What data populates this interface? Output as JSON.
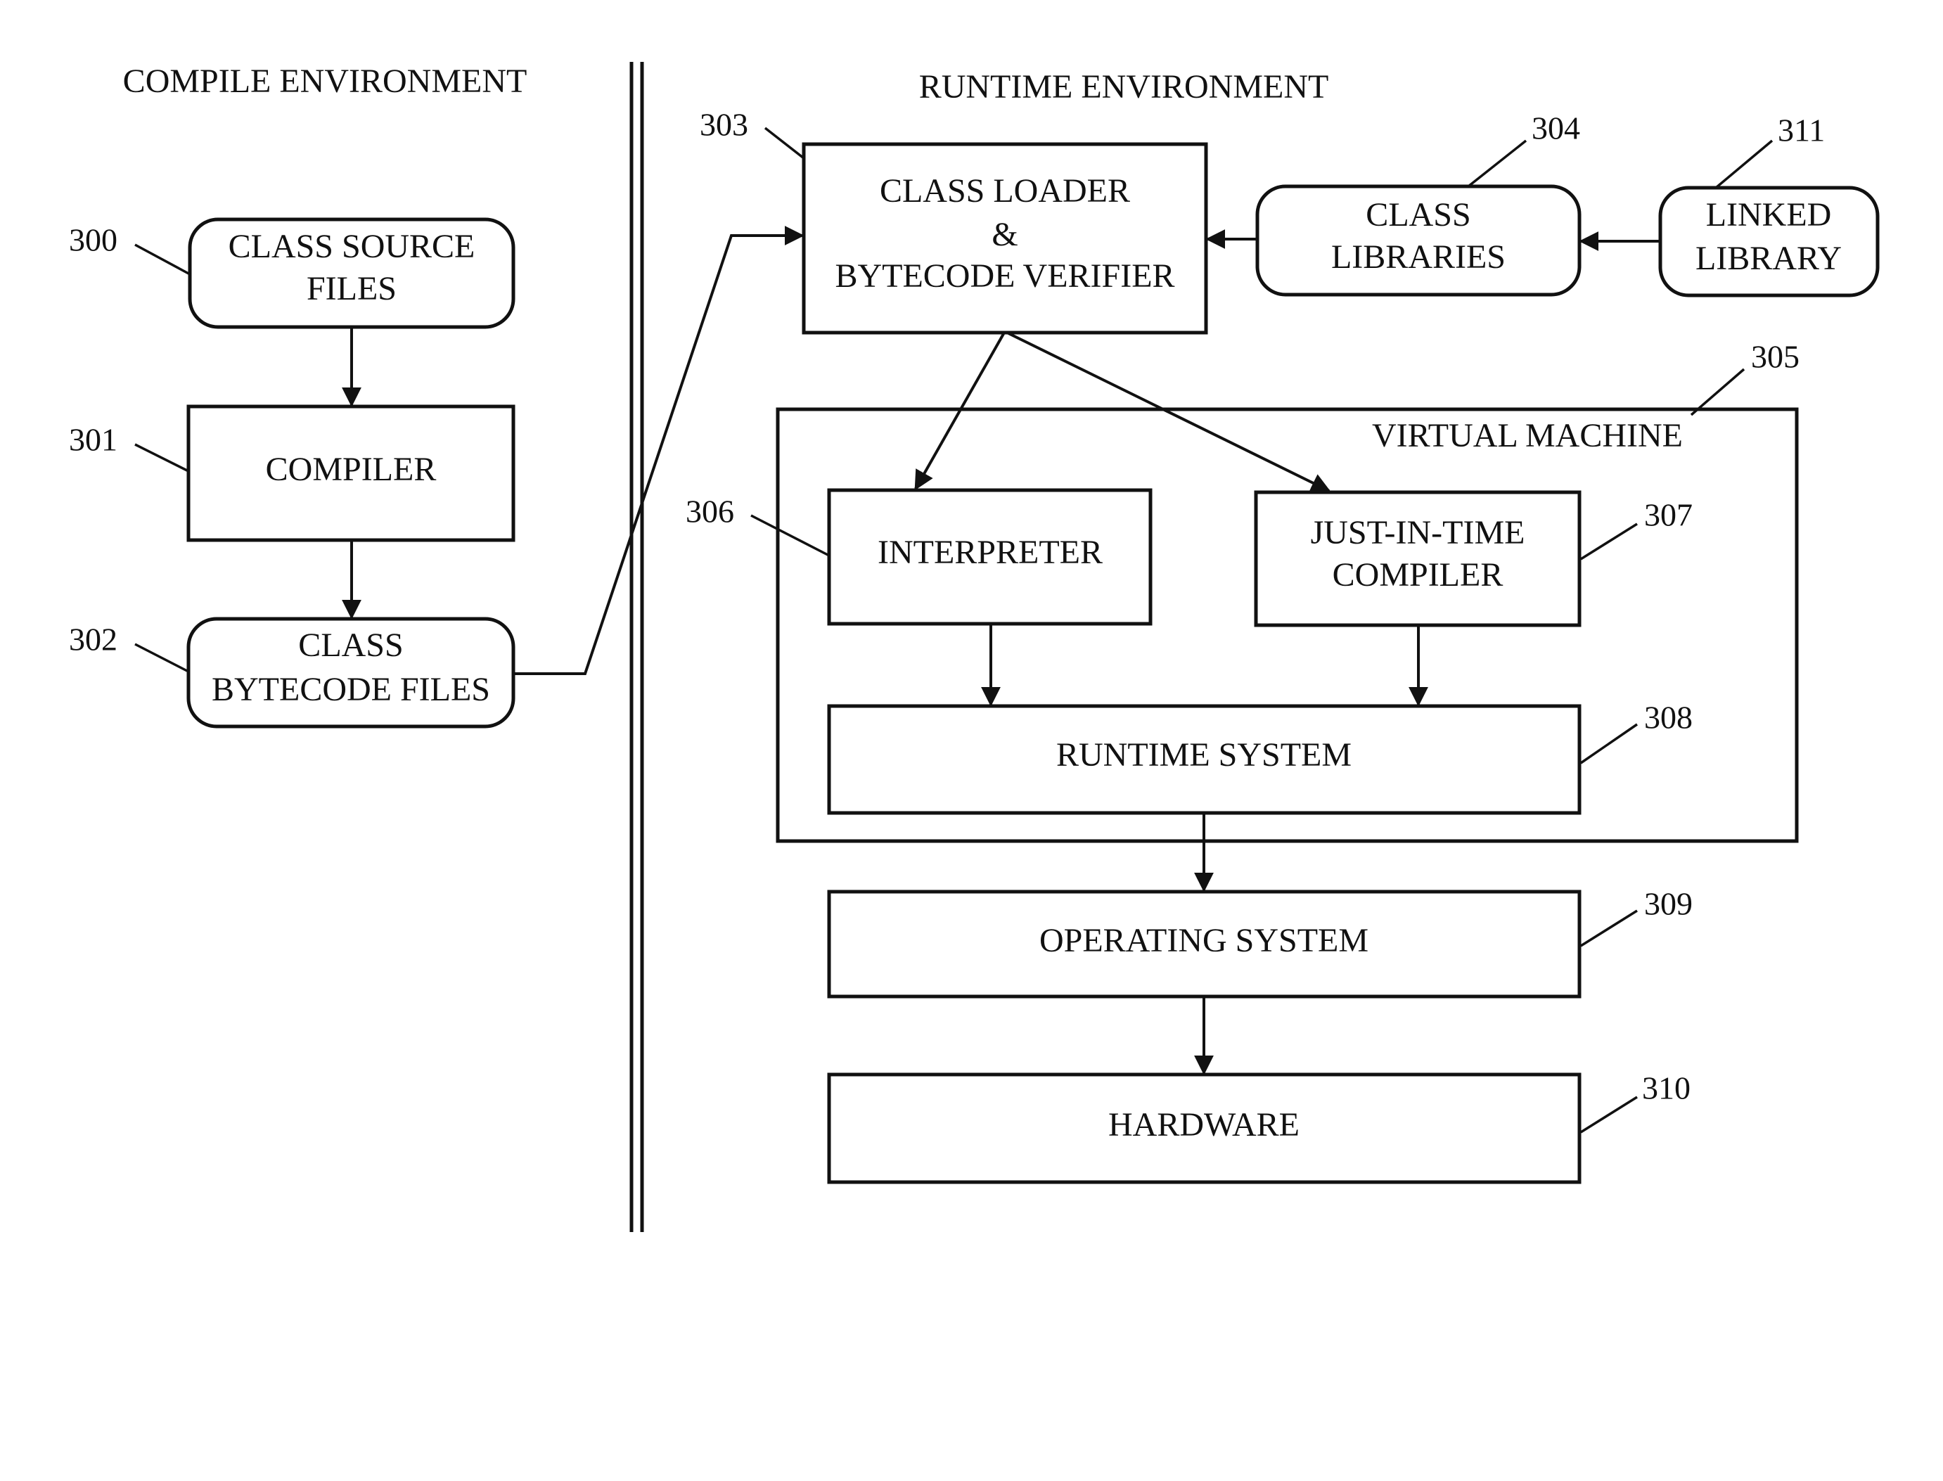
{
  "headings": {
    "compile": "COMPILE ENVIRONMENT",
    "runtime": "RUNTIME ENVIRONMENT"
  },
  "nodes": {
    "class_source_files": {
      "ref": "300",
      "line1": "CLASS SOURCE",
      "line2": "FILES",
      "shape": "rounded"
    },
    "compiler": {
      "ref": "301",
      "line1": "COMPILER",
      "shape": "rect"
    },
    "class_bytecode_files": {
      "ref": "302",
      "line1": "CLASS",
      "line2": "BYTECODE FILES",
      "shape": "rounded"
    },
    "class_loader": {
      "ref": "303",
      "line1": "CLASS LOADER",
      "line2": "&",
      "line3": "BYTECODE VERIFIER",
      "shape": "rect"
    },
    "class_libraries": {
      "ref": "304",
      "line1": "CLASS",
      "line2": "LIBRARIES",
      "shape": "rounded"
    },
    "virtual_machine": {
      "ref": "305",
      "line1": "VIRTUAL MACHINE",
      "shape": "container"
    },
    "interpreter": {
      "ref": "306",
      "line1": "INTERPRETER",
      "shape": "rect"
    },
    "jit_compiler": {
      "ref": "307",
      "line1": "JUST-IN-TIME",
      "line2": "COMPILER",
      "shape": "rect"
    },
    "runtime_system": {
      "ref": "308",
      "line1": "RUNTIME SYSTEM",
      "shape": "rect"
    },
    "operating_system": {
      "ref": "309",
      "line1": "OPERATING SYSTEM",
      "shape": "rect"
    },
    "hardware": {
      "ref": "310",
      "line1": "HARDWARE",
      "shape": "rect"
    },
    "linked_library": {
      "ref": "311",
      "line1": "LINKED",
      "line2": "LIBRARY",
      "shape": "rounded"
    }
  },
  "edges": [
    {
      "from": "class_source_files",
      "to": "compiler"
    },
    {
      "from": "compiler",
      "to": "class_bytecode_files"
    },
    {
      "from": "class_bytecode_files",
      "to": "class_loader"
    },
    {
      "from": "class_libraries",
      "to": "class_loader"
    },
    {
      "from": "linked_library",
      "to": "class_libraries"
    },
    {
      "from": "class_loader",
      "to": "interpreter"
    },
    {
      "from": "class_loader",
      "to": "jit_compiler"
    },
    {
      "from": "interpreter",
      "to": "runtime_system"
    },
    {
      "from": "jit_compiler",
      "to": "runtime_system"
    },
    {
      "from": "runtime_system",
      "to": "operating_system"
    },
    {
      "from": "operating_system",
      "to": "hardware"
    }
  ]
}
